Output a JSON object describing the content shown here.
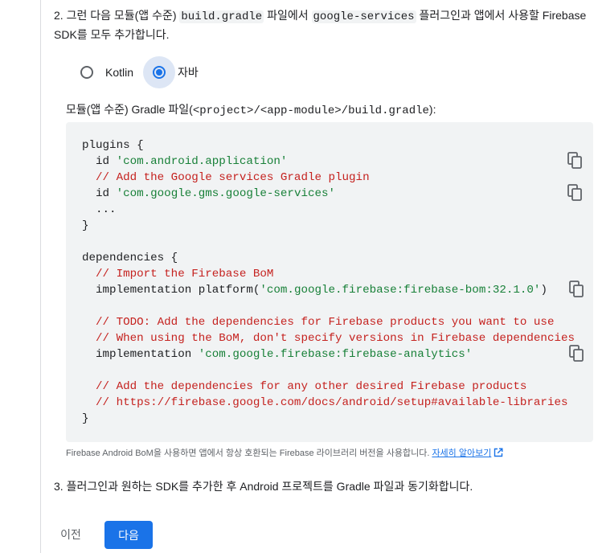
{
  "step2": {
    "number": "2.",
    "text_a": " 그런 다음 모듈(앱 수준) ",
    "code_a": "build.gradle",
    "text_b": " 파일에서 ",
    "code_b": "google-services",
    "text_c": " 플러그인과 앱에서 사용할 Firebase SDK를 모두 추가합니다."
  },
  "language": {
    "options": [
      {
        "label": "Kotlin",
        "selected": false
      },
      {
        "label": "자바",
        "selected": true
      }
    ]
  },
  "file_label": {
    "prefix": "모듈(앱 수준) Gradle 파일(",
    "path": "<project>/<app-module>/build.gradle",
    "suffix": "):"
  },
  "code": {
    "lines": {
      "l1": "plugins {",
      "l2_kw": "  id ",
      "l2_str": "'com.android.application'",
      "l3_cmt": "  // Add the Google services Gradle plugin",
      "l4_kw": "  id ",
      "l4_str": "'com.google.gms.google-services'",
      "l5": "  ...",
      "l6": "}",
      "l8": "dependencies {",
      "l9_cmt": "  // Import the Firebase BoM",
      "l10_a": "  implementation platform(",
      "l10_str": "'com.google.firebase:firebase-bom:32.1.0'",
      "l10_b": ")",
      "l12_cmt": "  // TODO: Add the dependencies for Firebase products you want to use",
      "l13_cmt": "  // When using the BoM, don't specify versions in Firebase dependencies",
      "l14_a": "  implementation ",
      "l14_str": "'com.google.firebase:firebase-analytics'",
      "l16_cmt": "  // Add the dependencies for any other desired Firebase products",
      "l17_cmt": "  // https://firebase.google.com/docs/android/setup#available-libraries",
      "l18": "}"
    },
    "copy_icon": "copy-icon"
  },
  "note": {
    "text": "Firebase Android BoM을 사용하면 앱에서 항상 호환되는 Firebase 라이브러리 버전을 사용합니다. ",
    "link": "자세히 알아보기",
    "link_icon": "external-link-icon"
  },
  "step3": {
    "number": "3.",
    "text": " 플러그인과 원하는 SDK를 추가한 후 Android 프로젝트를 Gradle 파일과 동기화합니다."
  },
  "buttons": {
    "prev": "이전",
    "next": "다음"
  },
  "colors": {
    "accent": "#1a73e8",
    "code_bg": "#f1f3f4",
    "string": "#188038",
    "comment": "#c5221f"
  }
}
